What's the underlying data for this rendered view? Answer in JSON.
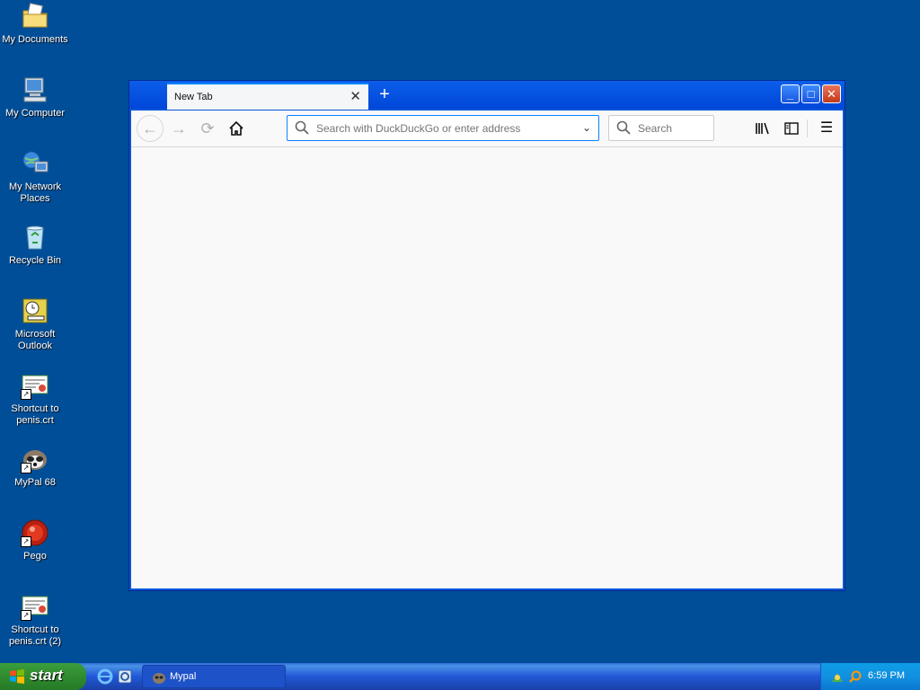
{
  "desktop": {
    "icons": [
      {
        "label": "My Documents",
        "icon": "folder-documents-icon"
      },
      {
        "label": "My Computer",
        "icon": "computer-icon"
      },
      {
        "label": "My Network Places",
        "icon": "network-icon"
      },
      {
        "label": "Recycle Bin",
        "icon": "recycle-bin-icon"
      },
      {
        "label": "Microsoft Outlook",
        "icon": "outlook-icon"
      },
      {
        "label": "Shortcut to penis.crt",
        "icon": "certificate-icon"
      },
      {
        "label": "MyPal 68",
        "icon": "mypal-icon"
      },
      {
        "label": "Pego",
        "icon": "pego-icon"
      },
      {
        "label": "Shortcut to penis.crt (2)",
        "icon": "certificate-icon"
      }
    ]
  },
  "browser": {
    "tab_title": "New Tab",
    "urlbar": {
      "placeholder": "Search with DuckDuckGo or enter address",
      "value": ""
    },
    "searchbar": {
      "placeholder": "Search",
      "value": ""
    }
  },
  "taskbar": {
    "start_label": "start",
    "task_label": "Mypal",
    "clock": "6:59 PM"
  },
  "colors": {
    "desktop_bg": "#004e98",
    "window_frame": "#0a55d8",
    "url_focus": "#0a84ff",
    "start_green": "#2f8c2f"
  }
}
